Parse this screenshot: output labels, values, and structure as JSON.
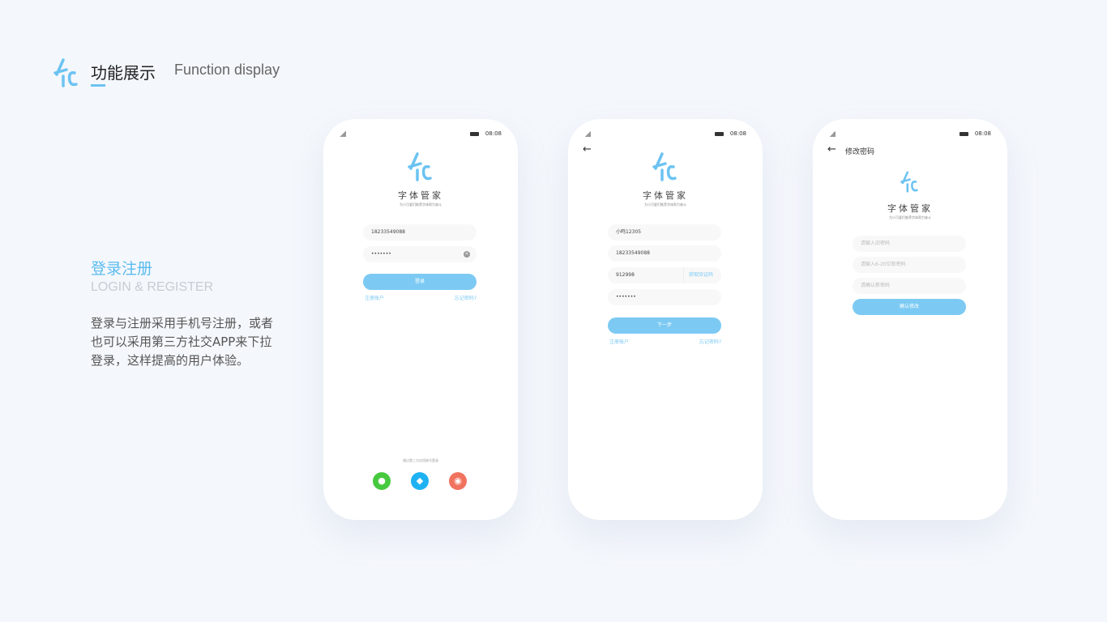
{
  "header": {
    "title_cn": "功能展示",
    "title_en": "Function display",
    "accent": "#6cc3f2"
  },
  "section": {
    "title_cn": "登录注册",
    "title_en": "LOGIN & REGISTER",
    "description": "登录与注册采用手机号注册，或者也可以采用第三方社交APP来下拉登录，这样提高的用户体验。"
  },
  "brand": {
    "name": "字体管家",
    "slogan": "为小可爱们推荐字体帮力奋斗"
  },
  "status": {
    "time": "08:08"
  },
  "login": {
    "phone": "18233549088",
    "password": "•••••••",
    "login_button": "登录",
    "register_link": "注册账户",
    "forgot_link": "忘记密码?",
    "third_party_label": "通过第三方应用账号登录",
    "social": [
      "wechat-icon",
      "qq-icon",
      "weibo-icon"
    ]
  },
  "register": {
    "username": "小鸣12305",
    "phone": "18233549088",
    "code": "912998",
    "get_code": "获取验证码",
    "password": "•••••••",
    "next_button": "下一步",
    "register_link": "注册账户",
    "forgot_link": "忘记密码?"
  },
  "change_password": {
    "title": "修改密码",
    "old_placeholder": "请输入旧密码",
    "new_placeholder": "请输入6-20位新密码",
    "confirm_placeholder": "请确认新密码",
    "confirm_button": "确认修改"
  }
}
